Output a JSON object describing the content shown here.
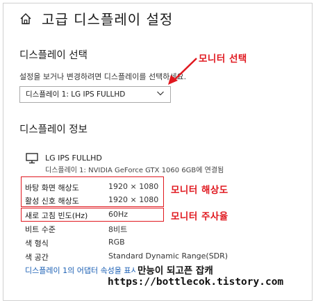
{
  "page": {
    "title": "고급 디스플레이 설정"
  },
  "display_select": {
    "heading": "디스플레이 선택",
    "hint": "설정을 보거나 변경하려면 디스플레이를 선택하세요.",
    "selected": "디스플레이 1: LG IPS FULLHD"
  },
  "display_info": {
    "heading": "디스플레이 정보",
    "monitor_name": "LG IPS FULLHD",
    "monitor_sub": "디스플레이 1: NVIDIA GeForce GTX 1060 6GB에 연결됨",
    "properties": [
      {
        "label": "바탕 화면 해상도",
        "value": "1920 × 1080"
      },
      {
        "label": "활성 신호 해상도",
        "value": "1920 × 1080"
      },
      {
        "label": "새로 고침 빈도(Hz)",
        "value": "60Hz"
      },
      {
        "label": "비트 수준",
        "value": "8비트"
      },
      {
        "label": "색 형식",
        "value": "RGB"
      },
      {
        "label": "색 공간",
        "value": "Standard Dynamic Range(SDR)"
      }
    ],
    "adapter_link": "디스플레이 1의 어댑터 속성을 표시"
  },
  "annotations": {
    "monitor_select": "모니터 선택",
    "monitor_resolution": "모니터 해상도",
    "monitor_refresh": "모니터 주사율",
    "color": "#e0181f"
  },
  "watermark": {
    "line1": "만능이 되고픈 잡캐",
    "line2": "https://bottlecok.tistory.com"
  },
  "icons": {
    "home": "home-icon",
    "dropdown": "chevron-down-icon",
    "monitor": "monitor-icon"
  }
}
